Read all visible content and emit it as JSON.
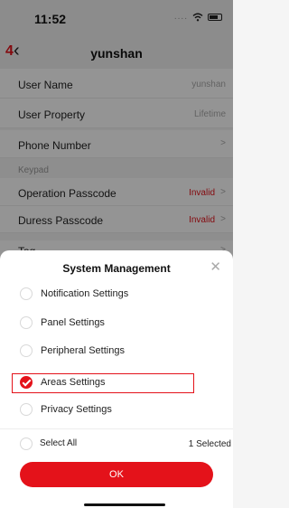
{
  "status": {
    "time": "11:52",
    "signal_dots": "...."
  },
  "nav": {
    "step": "4",
    "title": "yunshan"
  },
  "rows": [
    {
      "label": "User Name",
      "value": "yunshan"
    },
    {
      "label": "User Property",
      "value": "Lifetime"
    },
    {
      "label": "Phone Number",
      "value": ">"
    },
    {
      "label": "Operation Passcode",
      "value": "Invalid"
    },
    {
      "label": "Duress Passcode",
      "value": "Invalid"
    },
    {
      "label": "Tag",
      "value": ">"
    }
  ],
  "section_label": "Keypad",
  "sheet": {
    "title": "System Management",
    "options": [
      {
        "label": "Notification Settings",
        "checked": false
      },
      {
        "label": "Panel Settings",
        "checked": false
      },
      {
        "label": "Peripheral Settings",
        "checked": false
      },
      {
        "label": "Areas Settings",
        "checked": true
      },
      {
        "label": "Privacy Settings",
        "checked": false
      }
    ],
    "select_all_label": "Select All",
    "selected_count": "1 Selected",
    "ok_label": "OK"
  },
  "colors": {
    "accent": "#e4121a",
    "overlay": "rgba(0,0,0,0.42)"
  },
  "icons": [
    "wifi-icon",
    "battery-icon",
    "back-chevron-icon",
    "close-icon",
    "checkmark-icon"
  ]
}
